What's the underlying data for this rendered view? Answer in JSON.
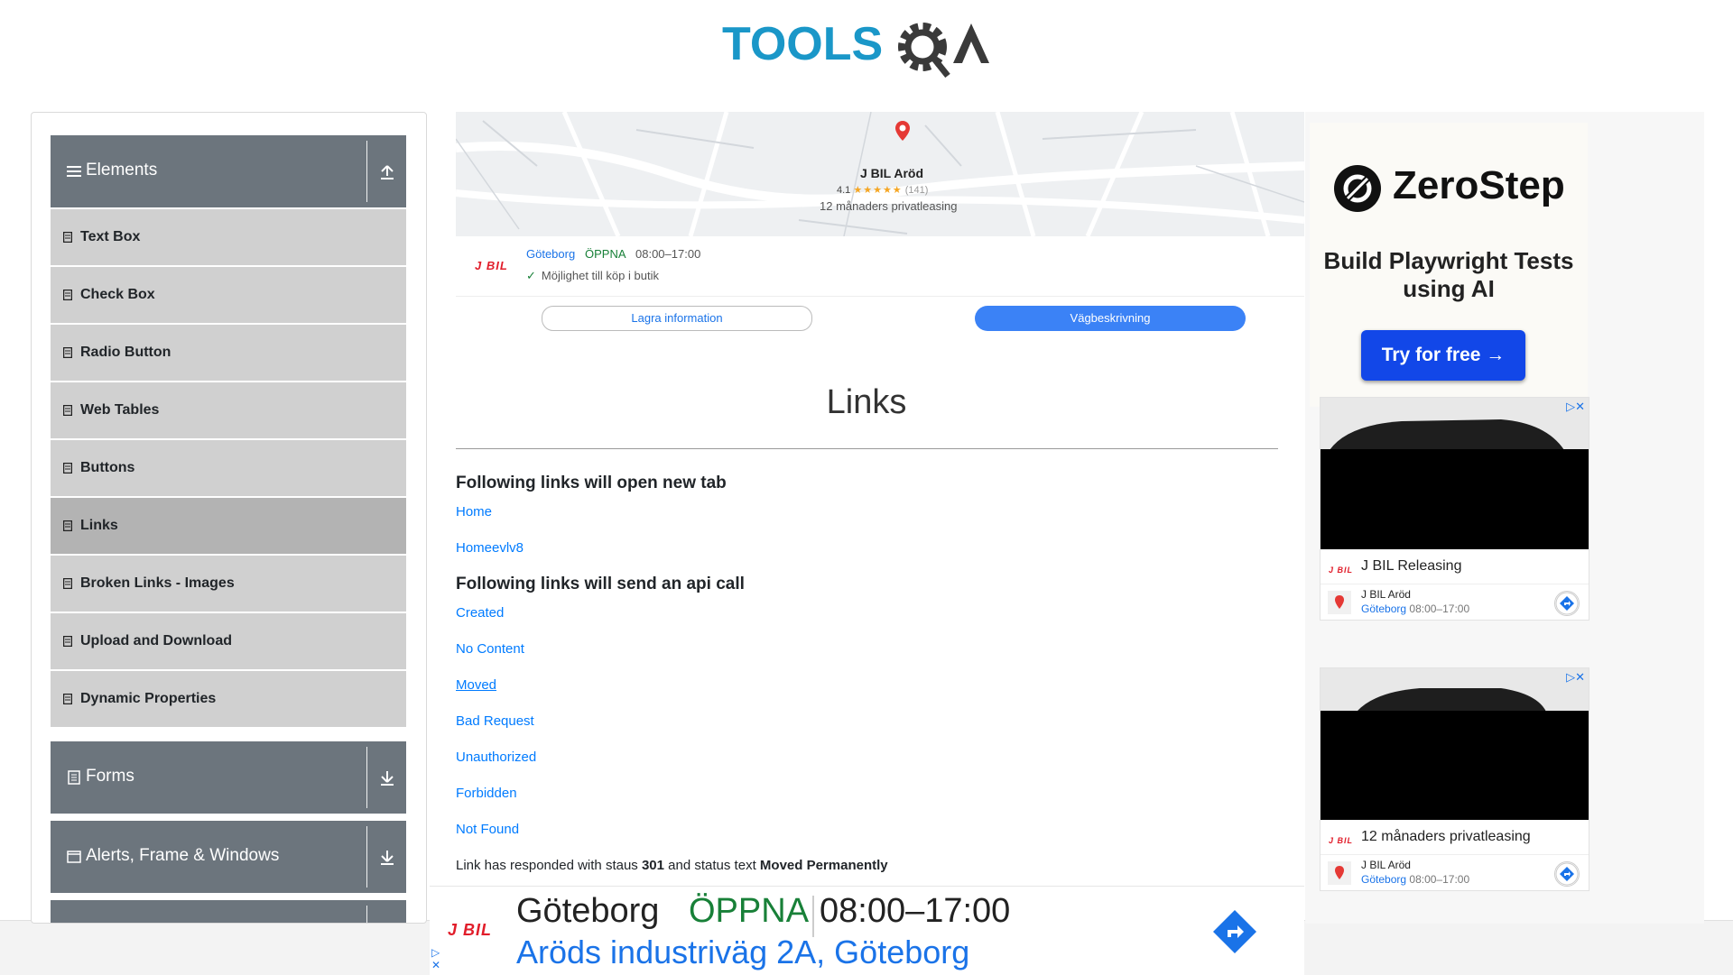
{
  "logo": {
    "text_tools": "TOOLS",
    "text_qa": "QA"
  },
  "sidebar": {
    "groups": [
      {
        "label": "Elements",
        "icon": "menu-icon",
        "arrow": "collapse-up-icon"
      },
      {
        "label": "Forms",
        "icon": "document-icon",
        "arrow": "expand-down-icon"
      },
      {
        "label": "Alerts, Frame & Windows",
        "icon": "window-icon",
        "arrow": "expand-down-icon"
      }
    ],
    "items": [
      {
        "label": "Text Box"
      },
      {
        "label": "Check Box"
      },
      {
        "label": "Radio Button"
      },
      {
        "label": "Web Tables"
      },
      {
        "label": "Buttons"
      },
      {
        "label": "Links"
      },
      {
        "label": "Broken Links - Images"
      },
      {
        "label": "Upload and Download"
      },
      {
        "label": "Dynamic Properties"
      }
    ],
    "active_item": "Links"
  },
  "map_ad": {
    "pin_title": "J BIL Aröd",
    "rating": "4.1",
    "stars": "★★★★★",
    "review_count": "(141)",
    "pin_subtitle": "12 månaders privatleasing",
    "brand": "J BIL",
    "city": "Göteborg",
    "open_status": "ÖPPNA",
    "hours": "08:00–17:00",
    "feature": "Möjlighet till köp i butik",
    "save_button": "Lagra information",
    "directions_button": "Vägbeskrivning"
  },
  "main": {
    "title": "Links",
    "section1_heading": "Following links will open new tab",
    "section1_links": [
      "Home",
      "Homeevlv8"
    ],
    "section2_heading": "Following links will send an api call",
    "section2_links": [
      "Created",
      "No Content",
      "Moved",
      "Bad Request",
      "Unauthorized",
      "Forbidden",
      "Not Found"
    ],
    "hovered_link": "Moved",
    "response_prefix": "Link has responded with staus",
    "response_code": "301",
    "response_middle": "and status text",
    "response_text": "Moved Permanently"
  },
  "right_ad": {
    "zerostep_name": "ZeroStep",
    "zerostep_tagline": "Build Playwright Tests using AI",
    "zerostep_button": "Try for free →",
    "cards": [
      {
        "brand": "J BIL",
        "title": "J BIL Releasing",
        "place": "J BIL Aröd",
        "city": "Göteborg",
        "hours": "08:00–17:00"
      },
      {
        "brand": "J BIL",
        "title": "12 månaders privatleasing",
        "place": "J BIL Aröd",
        "city": "Göteborg",
        "hours": "08:00–17:00"
      }
    ]
  },
  "banner": {
    "brand": "J BIL",
    "city": "Göteborg",
    "open_status": "ÖPPNA",
    "hours": "08:00–17:00",
    "address": "Aröds industriväg 2A, Göteborg"
  },
  "colors": {
    "sidebar_header": "#6c757d",
    "menu_item": "#d0d0d0",
    "link": "#007bff",
    "accent_blue": "#3b82f6",
    "zerostep_button": "#1247e8"
  }
}
